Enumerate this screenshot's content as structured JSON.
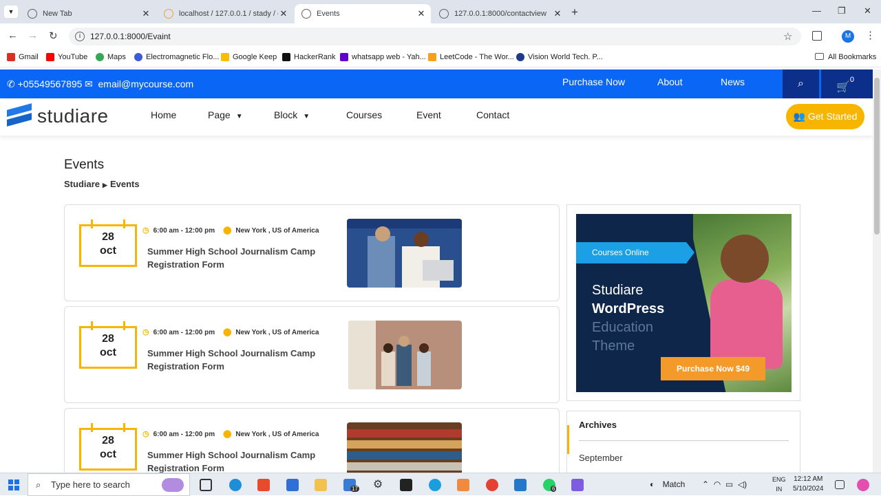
{
  "browser": {
    "tabs": [
      {
        "title": "New Tab"
      },
      {
        "title": "localhost / 127.0.0.1 / stady / co"
      },
      {
        "title": "Events"
      },
      {
        "title": "127.0.0.1:8000/contactview"
      }
    ],
    "url": "127.0.0.1:8000/Evaint",
    "profile_initial": "M",
    "bookmarks": [
      {
        "label": "Gmail",
        "color": "#d93025"
      },
      {
        "label": "YouTube",
        "color": "#ff0000"
      },
      {
        "label": "Maps",
        "color": "#34a853"
      },
      {
        "label": "Electromagnetic Flo...",
        "color": "#3b5bdb"
      },
      {
        "label": "Google Keep",
        "color": "#fbbc04"
      },
      {
        "label": "HackerRank",
        "color": "#111"
      },
      {
        "label": "whatsapp web - Yah...",
        "color": "#6001d2"
      },
      {
        "label": "LeetCode - The Wor...",
        "color": "#f89f1b"
      },
      {
        "label": "Vision World Tech. P...",
        "color": "#1e3a8a"
      }
    ],
    "all_bookmarks": "All Bookmarks"
  },
  "topbar": {
    "phone": "+05549567895",
    "email": "email@mycourse.com",
    "links": [
      "Purchase Now",
      "About",
      "News"
    ],
    "cart_count": "0"
  },
  "nav": {
    "logo": "studiare",
    "items": [
      "Home",
      "Page",
      "Block",
      "Courses",
      "Event",
      "Contact"
    ],
    "cta": "Get Started"
  },
  "page": {
    "title": "Events",
    "breadcrumb": [
      "Studiare",
      "Events"
    ]
  },
  "events": [
    {
      "day": "28",
      "month": "oct",
      "time": "6:00 am - 12:00 pm",
      "location": "New York , US of America",
      "title": "Summer High School Journalism Camp Registration Form"
    },
    {
      "day": "28",
      "month": "oct",
      "time": "6:00 am - 12:00 pm",
      "location": "New York , US of America",
      "title": "Summer High School Journalism Camp Registration Form"
    },
    {
      "day": "28",
      "month": "oct",
      "time": "6:00 am - 12:00 pm",
      "location": "New York , US of America",
      "title": "Summer High School Journalism Camp Registration Form"
    }
  ],
  "ad": {
    "ribbon": "Courses Online",
    "line1": "Studiare",
    "line2": "WordPress",
    "line3": "Education",
    "line4": "Theme",
    "button": "Purchase Now $49"
  },
  "archives": {
    "heading": "Archives",
    "items": [
      "September"
    ]
  },
  "taskbar": {
    "search_placeholder": "Type here to search",
    "weather": "Match",
    "lang1": "ENG",
    "lang2": "IN",
    "time": "12:12 AM",
    "date": "5/10/2024",
    "mail_badge": "17",
    "whatsapp_badge": "6"
  }
}
